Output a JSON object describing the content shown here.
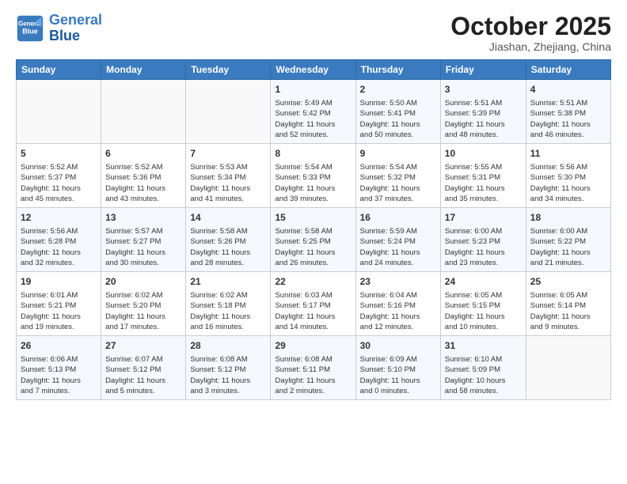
{
  "header": {
    "logo_line1": "General",
    "logo_line2": "Blue",
    "month": "October 2025",
    "location": "Jiashan, Zhejiang, China"
  },
  "weekdays": [
    "Sunday",
    "Monday",
    "Tuesday",
    "Wednesday",
    "Thursday",
    "Friday",
    "Saturday"
  ],
  "weeks": [
    [
      {
        "day": "",
        "info": ""
      },
      {
        "day": "",
        "info": ""
      },
      {
        "day": "",
        "info": ""
      },
      {
        "day": "1",
        "info": "Sunrise: 5:49 AM\nSunset: 5:42 PM\nDaylight: 11 hours\nand 52 minutes."
      },
      {
        "day": "2",
        "info": "Sunrise: 5:50 AM\nSunset: 5:41 PM\nDaylight: 11 hours\nand 50 minutes."
      },
      {
        "day": "3",
        "info": "Sunrise: 5:51 AM\nSunset: 5:39 PM\nDaylight: 11 hours\nand 48 minutes."
      },
      {
        "day": "4",
        "info": "Sunrise: 5:51 AM\nSunset: 5:38 PM\nDaylight: 11 hours\nand 46 minutes."
      }
    ],
    [
      {
        "day": "5",
        "info": "Sunrise: 5:52 AM\nSunset: 5:37 PM\nDaylight: 11 hours\nand 45 minutes."
      },
      {
        "day": "6",
        "info": "Sunrise: 5:52 AM\nSunset: 5:36 PM\nDaylight: 11 hours\nand 43 minutes."
      },
      {
        "day": "7",
        "info": "Sunrise: 5:53 AM\nSunset: 5:34 PM\nDaylight: 11 hours\nand 41 minutes."
      },
      {
        "day": "8",
        "info": "Sunrise: 5:54 AM\nSunset: 5:33 PM\nDaylight: 11 hours\nand 39 minutes."
      },
      {
        "day": "9",
        "info": "Sunrise: 5:54 AM\nSunset: 5:32 PM\nDaylight: 11 hours\nand 37 minutes."
      },
      {
        "day": "10",
        "info": "Sunrise: 5:55 AM\nSunset: 5:31 PM\nDaylight: 11 hours\nand 35 minutes."
      },
      {
        "day": "11",
        "info": "Sunrise: 5:56 AM\nSunset: 5:30 PM\nDaylight: 11 hours\nand 34 minutes."
      }
    ],
    [
      {
        "day": "12",
        "info": "Sunrise: 5:56 AM\nSunset: 5:28 PM\nDaylight: 11 hours\nand 32 minutes."
      },
      {
        "day": "13",
        "info": "Sunrise: 5:57 AM\nSunset: 5:27 PM\nDaylight: 11 hours\nand 30 minutes."
      },
      {
        "day": "14",
        "info": "Sunrise: 5:58 AM\nSunset: 5:26 PM\nDaylight: 11 hours\nand 28 minutes."
      },
      {
        "day": "15",
        "info": "Sunrise: 5:58 AM\nSunset: 5:25 PM\nDaylight: 11 hours\nand 26 minutes."
      },
      {
        "day": "16",
        "info": "Sunrise: 5:59 AM\nSunset: 5:24 PM\nDaylight: 11 hours\nand 24 minutes."
      },
      {
        "day": "17",
        "info": "Sunrise: 6:00 AM\nSunset: 5:23 PM\nDaylight: 11 hours\nand 23 minutes."
      },
      {
        "day": "18",
        "info": "Sunrise: 6:00 AM\nSunset: 5:22 PM\nDaylight: 11 hours\nand 21 minutes."
      }
    ],
    [
      {
        "day": "19",
        "info": "Sunrise: 6:01 AM\nSunset: 5:21 PM\nDaylight: 11 hours\nand 19 minutes."
      },
      {
        "day": "20",
        "info": "Sunrise: 6:02 AM\nSunset: 5:20 PM\nDaylight: 11 hours\nand 17 minutes."
      },
      {
        "day": "21",
        "info": "Sunrise: 6:02 AM\nSunset: 5:18 PM\nDaylight: 11 hours\nand 16 minutes."
      },
      {
        "day": "22",
        "info": "Sunrise: 6:03 AM\nSunset: 5:17 PM\nDaylight: 11 hours\nand 14 minutes."
      },
      {
        "day": "23",
        "info": "Sunrise: 6:04 AM\nSunset: 5:16 PM\nDaylight: 11 hours\nand 12 minutes."
      },
      {
        "day": "24",
        "info": "Sunrise: 6:05 AM\nSunset: 5:15 PM\nDaylight: 11 hours\nand 10 minutes."
      },
      {
        "day": "25",
        "info": "Sunrise: 6:05 AM\nSunset: 5:14 PM\nDaylight: 11 hours\nand 9 minutes."
      }
    ],
    [
      {
        "day": "26",
        "info": "Sunrise: 6:06 AM\nSunset: 5:13 PM\nDaylight: 11 hours\nand 7 minutes."
      },
      {
        "day": "27",
        "info": "Sunrise: 6:07 AM\nSunset: 5:12 PM\nDaylight: 11 hours\nand 5 minutes."
      },
      {
        "day": "28",
        "info": "Sunrise: 6:08 AM\nSunset: 5:12 PM\nDaylight: 11 hours\nand 3 minutes."
      },
      {
        "day": "29",
        "info": "Sunrise: 6:08 AM\nSunset: 5:11 PM\nDaylight: 11 hours\nand 2 minutes."
      },
      {
        "day": "30",
        "info": "Sunrise: 6:09 AM\nSunset: 5:10 PM\nDaylight: 11 hours\nand 0 minutes."
      },
      {
        "day": "31",
        "info": "Sunrise: 6:10 AM\nSunset: 5:09 PM\nDaylight: 10 hours\nand 58 minutes."
      },
      {
        "day": "",
        "info": ""
      }
    ]
  ]
}
